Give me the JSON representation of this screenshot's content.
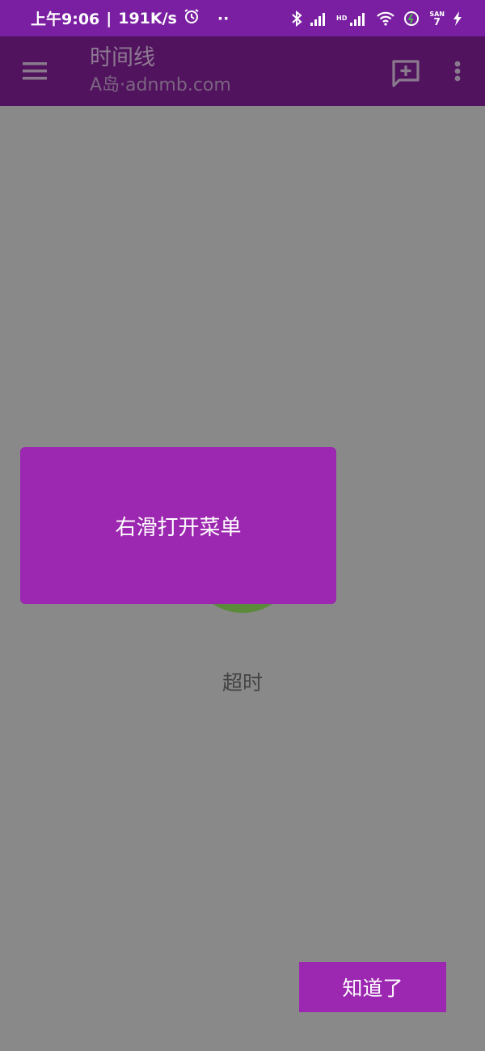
{
  "status_bar": {
    "time": "上午9:06",
    "separator": "|",
    "speed": "191K/s",
    "dots": "··",
    "sim_tag": "HD",
    "battery_level": "7",
    "battery_tag": "SAN"
  },
  "app_bar": {
    "title": "时间线",
    "subtitle": "A岛·adnmb.com"
  },
  "content": {
    "status_text": "超时"
  },
  "tip": {
    "message": "右滑打开菜单",
    "confirm_label": "知道了"
  },
  "colors": {
    "status_bar": "#7a1fa2",
    "app_bar_dimmed": "#51135e",
    "accent": "#9c27b0",
    "overlay": "#898989"
  }
}
